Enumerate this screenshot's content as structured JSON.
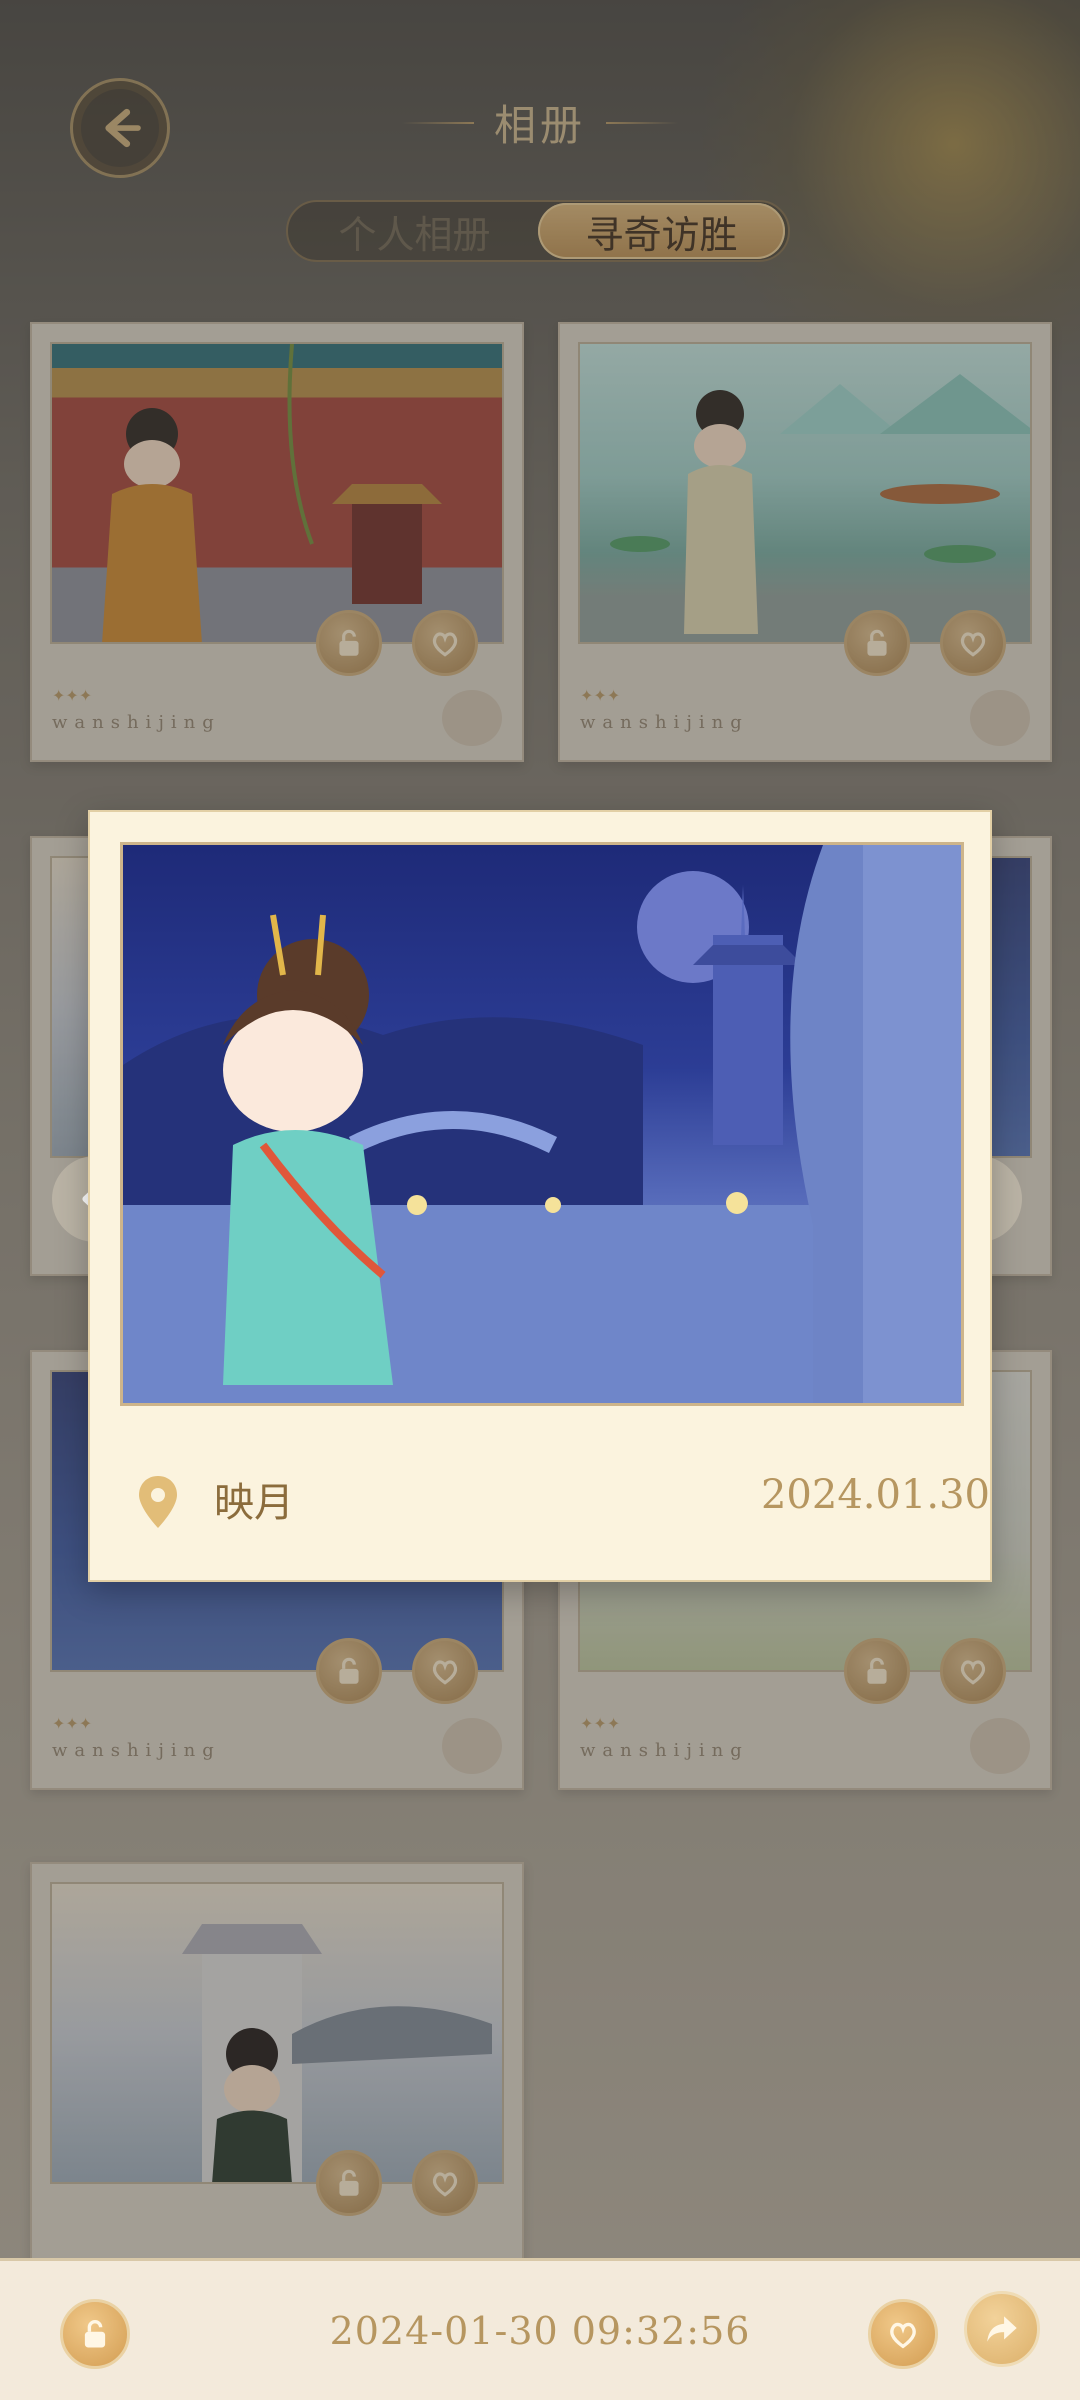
{
  "header": {
    "title": "相册",
    "tabs": [
      {
        "label": "个人相册",
        "active": false
      },
      {
        "label": "寻奇访胜",
        "active": true
      }
    ]
  },
  "cards": [
    {
      "brand": "wanshijing",
      "stars": "✦✦✦"
    },
    {
      "brand": "wanshijing",
      "stars": "✦✦✦"
    },
    {
      "brand": "wanshijing",
      "stars": "✦✦✦"
    },
    {
      "brand": "wanshijing",
      "stars": "✦✦✦"
    }
  ],
  "popup": {
    "location": "映月",
    "date": "2024.01.30"
  },
  "bottom_bar": {
    "timestamp": "2024-01-30 09:32:56"
  },
  "colors": {
    "accent_gold": "#b69660",
    "popup_bg": "#fbf3de",
    "bar_bg": "#f3eadb"
  },
  "icons": [
    "back-arrow-icon",
    "lock-icon",
    "heart-icon",
    "share-icon",
    "location-pin-icon",
    "chevron-left-icon",
    "chevron-right-icon"
  ]
}
